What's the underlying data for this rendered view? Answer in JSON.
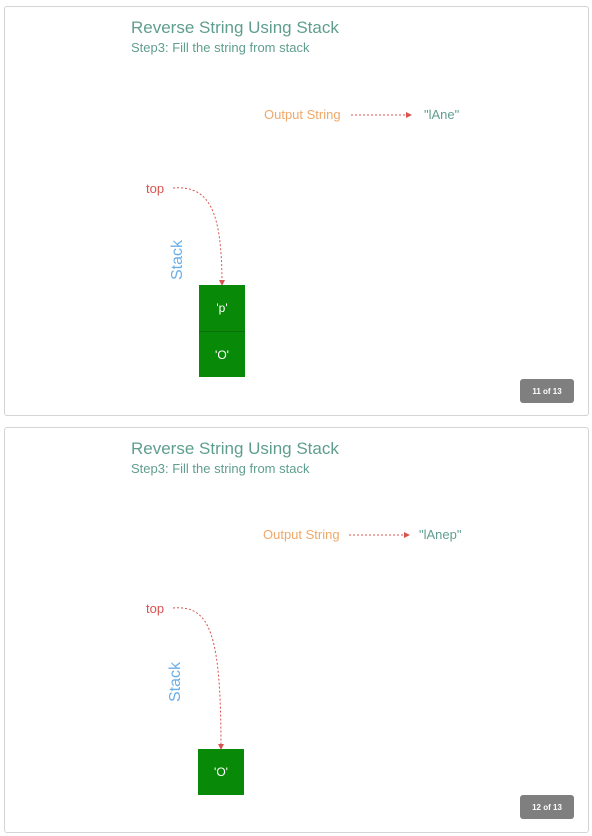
{
  "slides": [
    {
      "title": "Reverse String Using Stack",
      "subtitle": "Step3: Fill the string from stack",
      "output_label": "Output String",
      "output_value": "\"lAne\"",
      "top_label": "top",
      "stack_label": "Stack",
      "stack_items": [
        "'p'",
        "'O'"
      ],
      "counter": "11 of 13"
    },
    {
      "title": "Reverse String Using Stack",
      "subtitle": "Step3: Fill the string from stack",
      "output_label": "Output String",
      "output_value": "\"lAnep\"",
      "top_label": "top",
      "stack_label": "Stack",
      "stack_items": [
        "'O'"
      ],
      "counter": "12 of 13"
    }
  ],
  "colors": {
    "accent_teal": "#5f9e8e",
    "output_label": "#f0a868",
    "top_pointer": "#d9534f",
    "stack_label": "#6aaee8",
    "stack_cell": "#088a08",
    "counter_bg": "#7f7f7f"
  }
}
